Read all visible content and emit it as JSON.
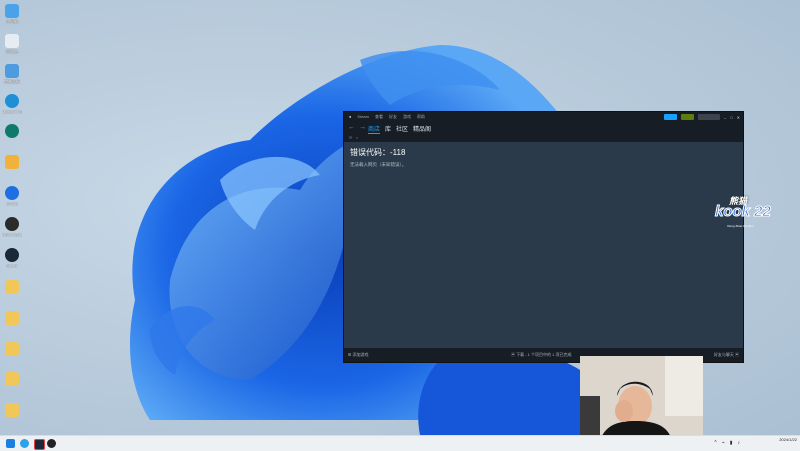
{
  "desktop": {
    "icons": [
      {
        "label": "此电脑",
        "icon": "computer-icon",
        "color": "#4aa3e8"
      },
      {
        "label": "回收站",
        "icon": "recycle-bin-icon",
        "color": "#e7ecf2"
      },
      {
        "label": "控制面板",
        "icon": "control-panel-icon",
        "color": "#4f9be0"
      },
      {
        "label": "Microsoft Edge",
        "icon": "edge-icon",
        "color": "#1f8fd6"
      },
      {
        "label": "",
        "icon": "app-icon",
        "color": "#0f7a6a"
      },
      {
        "label": "",
        "icon": "app-icon",
        "color": "#f0b23a"
      },
      {
        "label": "KOOK",
        "icon": "kook-icon",
        "color": "#1f6fe0"
      },
      {
        "label": "OBS Studio",
        "icon": "obs-icon",
        "color": "#2b2b2b"
      },
      {
        "label": "Steam",
        "icon": "steam-icon",
        "color": "#1b2838"
      },
      {
        "label": "",
        "icon": "folder-icon",
        "color": "#f1c75a"
      },
      {
        "label": "",
        "icon": "folder-icon",
        "color": "#f1c75a"
      },
      {
        "label": "",
        "icon": "folder-icon",
        "color": "#f1c75a"
      },
      {
        "label": "",
        "icon": "folder-icon",
        "color": "#f1c75a"
      },
      {
        "label": "",
        "icon": "folder-icon",
        "color": "#f1c75a"
      }
    ]
  },
  "steam": {
    "window_title": "Steam",
    "menu": [
      "Steam",
      "查看",
      "好友",
      "游戏",
      "帮助"
    ],
    "nav": {
      "back": "←",
      "forward": "→",
      "tabs": [
        "商店",
        "库",
        "社区",
        "精品阁"
      ]
    },
    "status": {
      "add_game": "添加游戏",
      "downloads": "下载 - 1 个项目中的 1 项已完成",
      "friends": "好友与聊天"
    },
    "error": {
      "title": "错误代码：-118",
      "message": "无法载入网页（未知错误）。"
    }
  },
  "watermark": {
    "top": "熊猫",
    "main": "kook 22",
    "sub": "Xiong Zhao Kai Zhu"
  },
  "taskbar": {
    "date": "2024/1/22",
    "tray": [
      "^",
      "⌁",
      "▮",
      "♪"
    ]
  },
  "colors": {
    "accent": "#1a9fff",
    "wallpaper_blue": "#1a5fe0",
    "steam_bg": "#2a3a4a",
    "steam_dark": "#171d25"
  }
}
